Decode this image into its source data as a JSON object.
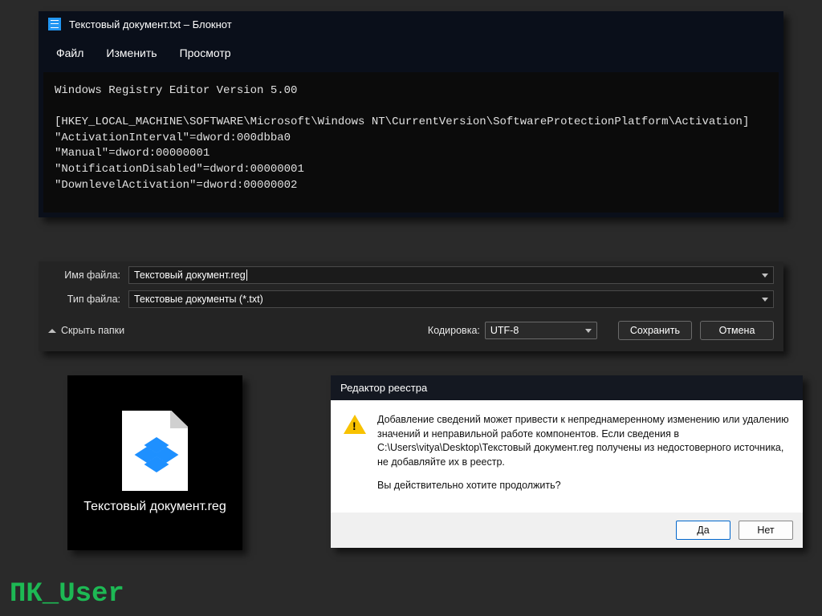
{
  "notepad": {
    "title": "Текстовый документ.txt – Блокнот",
    "menu": {
      "file": "Файл",
      "edit": "Изменить",
      "view": "Просмотр"
    },
    "content": "Windows Registry Editor Version 5.00\n\n[HKEY_LOCAL_MACHINE\\SOFTWARE\\Microsoft\\Windows NT\\CurrentVersion\\SoftwareProtectionPlatform\\Activation]\n\"ActivationInterval\"=dword:000dbba0\n\"Manual\"=dword:00000001\n\"NotificationDisabled\"=dword:00000001\n\"DownlevelActivation\"=dword:00000002"
  },
  "save": {
    "filename_label": "Имя файла:",
    "filename_value": "Текстовый документ.reg",
    "filetype_label": "Тип файла:",
    "filetype_value": "Текстовые документы (*.txt)",
    "hide_folders": "Скрыть папки",
    "encoding_label": "Кодировка:",
    "encoding_value": "UTF-8",
    "save_btn": "Сохранить",
    "cancel_btn": "Отмена"
  },
  "desktop": {
    "filename": "Текстовый документ.reg"
  },
  "regdlg": {
    "title": "Редактор реестра",
    "body": "Добавление сведений может привести к непреднамеренному изменению или удалению значений и неправильной работе компонентов. Если сведения в C:\\Users\\vitya\\Desktop\\Текстовый документ.reg получены из недостоверного источника, не добавляйте их в реестр.",
    "confirm": "Вы действительно хотите продолжить?",
    "yes": "Да",
    "no": "Нет"
  },
  "watermark": "ПК_User"
}
